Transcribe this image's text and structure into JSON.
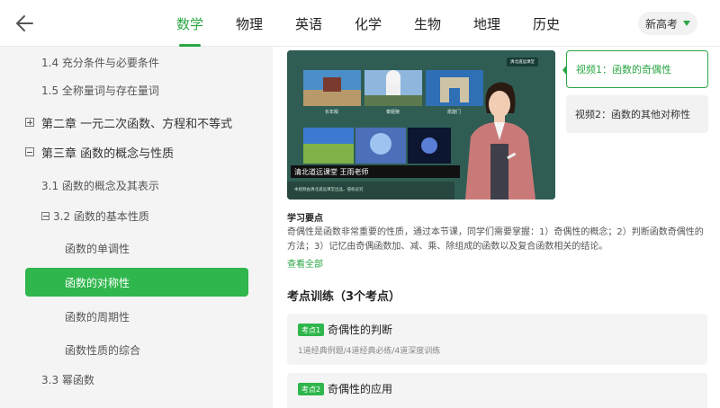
{
  "header": {
    "tabs": [
      "数学",
      "物理",
      "英语",
      "化学",
      "生物",
      "地理",
      "历史"
    ],
    "exam_button": "新高考",
    "accent": "#2aa644"
  },
  "sidebar": {
    "items": [
      {
        "label": "1.4 充分条件与必要条件",
        "level": 2
      },
      {
        "label": "1.5 全称量词与存在量词",
        "level": 2
      },
      {
        "label": "第二章 一元二次函数、方程和不等式",
        "level": 1,
        "icon": "plus-box-icon"
      },
      {
        "label": "第三章 函数的概念与性质",
        "level": 1,
        "icon": "minus-box-icon"
      },
      {
        "label": "3.1 函数的概念及其表示",
        "level": 2
      },
      {
        "label": "3.2 函数的基本性质",
        "level": 2,
        "icon": "minus-box-icon"
      },
      {
        "label": "函数的单调性",
        "level": 3
      },
      {
        "label": "函数的对称性",
        "level": 3,
        "active": true
      },
      {
        "label": "函数的周期性",
        "level": 3
      },
      {
        "label": "函数性质的综合",
        "level": 3
      },
      {
        "label": "3.3 幂函数",
        "level": 2
      }
    ]
  },
  "video": {
    "banner": "清北道远课堂   王雨老师",
    "board_tag": "清北道远课堂",
    "banner_sub": "本视频由清北道远课堂出品，侵权必究",
    "thumbs": [
      "长年殿",
      "泰姬陵",
      "凯旋门"
    ]
  },
  "video_list": [
    {
      "label": "视频1：函数的奇偶性",
      "active": true
    },
    {
      "label": "视频2：函数的其他对称性",
      "active": false
    }
  ],
  "study": {
    "title": "学习要点",
    "body": "奇偶性是函数非常重要的性质，通过本节课，同学们需要掌握：1）奇偶性的概念；2）判断函数奇偶性的方法；3）记忆由奇偶函数加、减、乘、除组成的函数以及复合函数相关的结论。",
    "view_all": "查看全部"
  },
  "training": {
    "title": "考点训练（3个考点）",
    "cards": [
      {
        "badge": "考点1",
        "name": "奇偶性的判断",
        "sub": "1道经典例题/4道经典必练/4道深度训练"
      },
      {
        "badge": "考点2",
        "name": "奇偶性的应用",
        "sub": ""
      }
    ]
  }
}
